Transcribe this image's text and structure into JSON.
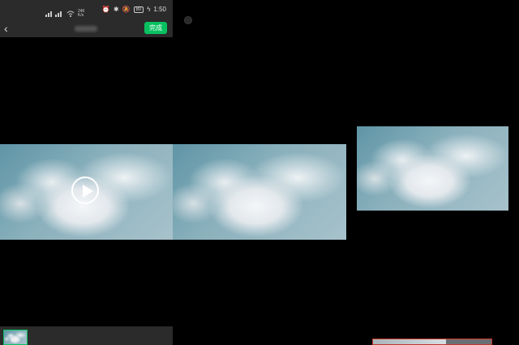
{
  "statusbar": {
    "network_speed_value": "246",
    "network_speed_unit": "K/s",
    "battery": "80",
    "time": "1:50"
  },
  "topbar": {
    "back_symbol": "‹",
    "done_label": "完成"
  },
  "icons": [
    "back-chevron-icon",
    "play-icon",
    "signal-icon",
    "wifi-icon",
    "alarm-icon",
    "bluetooth-icon",
    "mute-icon",
    "battery-icon",
    "charging-icon"
  ],
  "colors": {
    "accent": "#07c160",
    "bar_bg": "#2b2b2b",
    "strip_border": "#c0392b"
  }
}
